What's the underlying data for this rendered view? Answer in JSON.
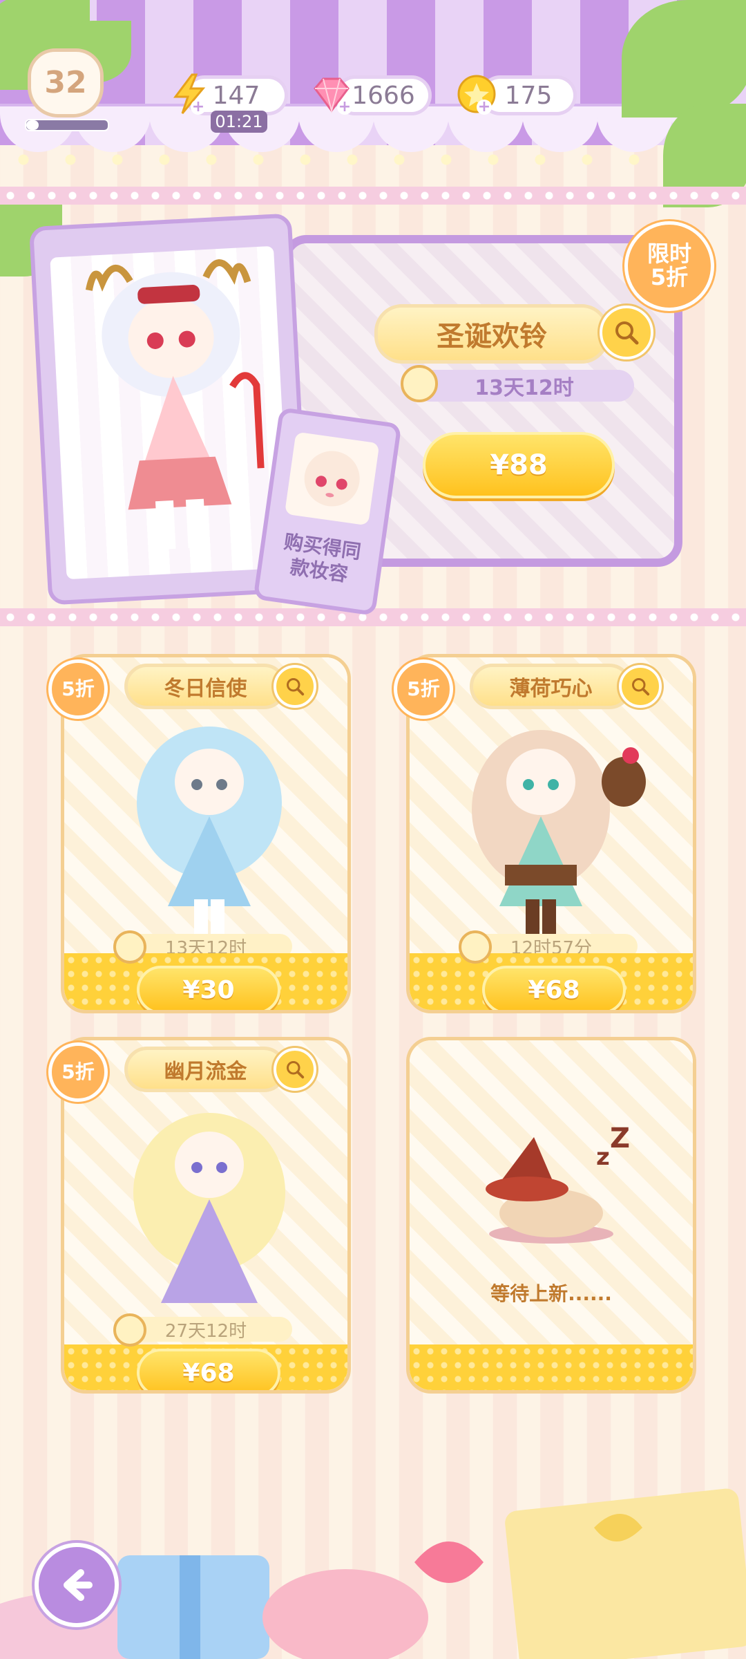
{
  "hud": {
    "level": "32",
    "exp_progress": 0.15,
    "stamina": {
      "value": "147",
      "timer": "01:21",
      "icon": "lightning-icon"
    },
    "gems": {
      "value": "1666",
      "icon": "diamond-icon"
    },
    "coins": {
      "value": "175",
      "icon": "coin-icon"
    }
  },
  "featured": {
    "badge": "限时\n5折",
    "title": "圣诞欢铃",
    "timer": "13天12时",
    "price": "¥88",
    "bonus_text": "购买得同\n款妆容"
  },
  "items": [
    {
      "badge": "5折",
      "title": "冬日信使",
      "timer": "13天12时",
      "price": "¥30",
      "theme": "#bfe4f6"
    },
    {
      "badge": "5折",
      "title": "薄荷巧心",
      "timer": "12时57分",
      "price": "¥68",
      "theme": "#f2d7c2"
    },
    {
      "badge": "5折",
      "title": "幽月流金",
      "timer": "27天12时",
      "price": "¥68",
      "theme": "#b9a3e6"
    }
  ],
  "empty_slot": {
    "text": "等待上新......"
  },
  "colors": {
    "accent_purple": "#c49ae0",
    "gold": "#ffc21e",
    "discount_orange": "#ffb45a"
  }
}
